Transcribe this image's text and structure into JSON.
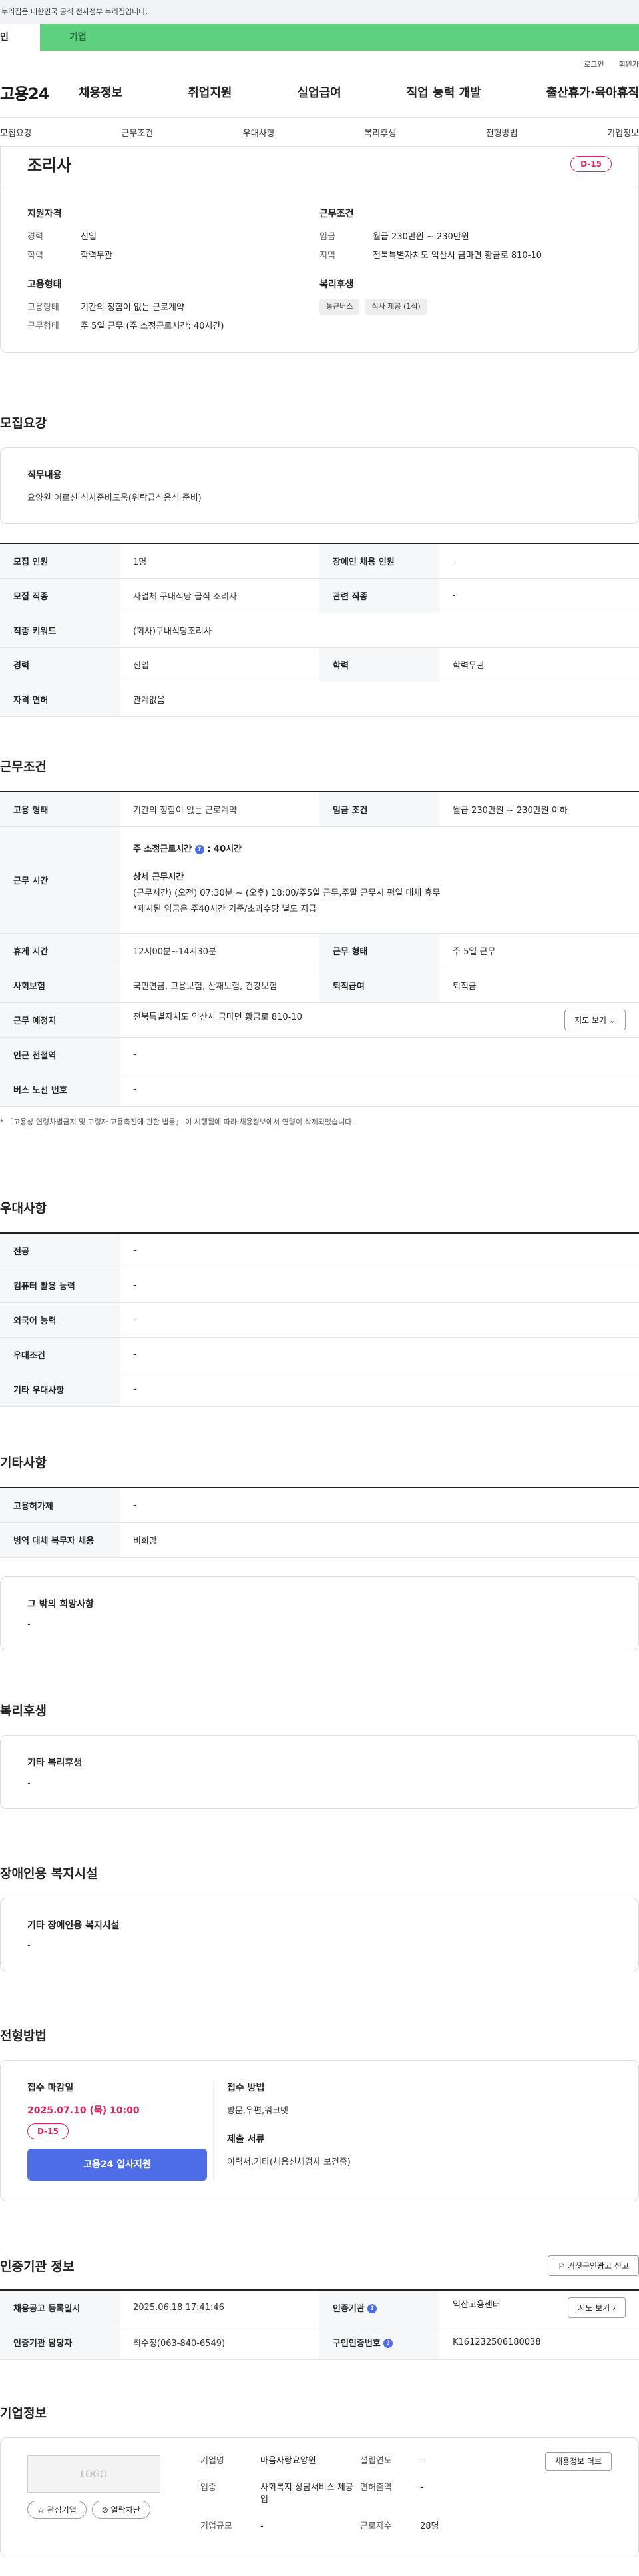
{
  "banner": "누리집은 대한민국 공식 전자정부 누리집입니다.",
  "tabs": {
    "a": "인",
    "b": "기업"
  },
  "util": {
    "login": "로그인",
    "join": "회원가"
  },
  "logo": "고용24",
  "gnb": [
    "채용정보",
    "취업지원",
    "실업급여",
    "직업 능력 개발",
    "출산휴가·육아휴직"
  ],
  "subtabs": [
    "모집요강",
    "근무조건",
    "우대사항",
    "복리후생",
    "전형방법",
    "기업정보"
  ],
  "job": {
    "title": "조리사",
    "dday": "D-15"
  },
  "summary": {
    "qual_h": "지원자격",
    "career_k": "경력",
    "career_v": "신입",
    "edu_k": "학력",
    "edu_v": "학력무관",
    "emp_h": "고용형태",
    "emptype_k": "고용형태",
    "emptype_v": "기간의 정함이 없는 근로계약",
    "workform_k": "근무형태",
    "workform_v": "주 5일 근무 (주 소정근로시간: 40시간)",
    "cond_h": "근무조건",
    "wage_k": "임금",
    "wage_v": "월급 230만원 ~ 230만원",
    "region_k": "지역",
    "region_v": "전북특별자치도 익산시 금마면 황금로 810-10",
    "welfare_h": "복리후생",
    "welfare_pills": [
      "통근버스",
      "식사 제공 (1식)"
    ]
  },
  "recruit": {
    "title": "모집요강",
    "duty_h": "직무내용",
    "duty_v": "요양원 어르신 식사준비도움(위탁급식음식 준비)",
    "rows": [
      [
        "모집 인원",
        "1명",
        "장애인 채용 인원",
        "-"
      ],
      [
        "모집 직종",
        "사업체 구내식당 급식 조리사",
        "관련 직종",
        "-"
      ],
      [
        "직종 키워드",
        "(회사)구내식당조리사"
      ],
      [
        "경력",
        "신입",
        "학력",
        "학력무관"
      ],
      [
        "자격 면허",
        "관계없음"
      ]
    ]
  },
  "work": {
    "title": "근무조건",
    "emp_k": "고용 형태",
    "emp_v": "기간의 정함이 없는 근로계약",
    "wage_k": "임금 조건",
    "wage_v": "월급 230만원 ~ 230만원 이하",
    "time_k": "근무 시간",
    "time_l1": "주 소정근로시간",
    "time_l1v": ": 40시간",
    "time_l2": "상세 근무시간",
    "time_l3": "(근무시간) (오전) 07:30분 ~ (오후) 18:00/주5일 근무,주말 근무시 평일 대체 휴무",
    "time_l4": "*제시된 임금은 주40시간 기준/초과수당 별도 지급",
    "rest_k": "휴게 시간",
    "rest_v": "12시00분~14시30분",
    "form_k": "근무 형태",
    "form_v": "주 5일 근무",
    "ins_k": "사회보험",
    "ins_v": "국민연금, 고용보험, 산재보험, 건강보험",
    "ret_k": "퇴직급여",
    "ret_v": "퇴직금",
    "place_k": "근무 예정지",
    "place_v": "전북특별자치도 익산시 금마면 황금로 810-10",
    "map": "지도 보기",
    "sub_k": "인근 전철역",
    "sub_v": "-",
    "bus_k": "버스 노선 번호",
    "bus_v": "-",
    "note": "* 「고용상 연령차별금지 및 고령자 고용촉진에 관한 법률」 이 시행됨에 따라 채용정보에서 연령이 삭제되었습니다."
  },
  "prefer": {
    "title": "우대사항",
    "rows": [
      [
        "전공",
        "-"
      ],
      [
        "컴퓨터 활용 능력",
        "-"
      ],
      [
        "외국어 능력",
        "-"
      ],
      [
        "우대조건",
        "-"
      ],
      [
        "기타 우대사항",
        "-"
      ]
    ]
  },
  "etc": {
    "title": "기타사항",
    "rows": [
      [
        "고용허가제",
        "-"
      ],
      [
        "병역 대체 복무자 채용",
        "비희망"
      ]
    ],
    "other_h": "그 밖의 희망사항",
    "other_v": "-"
  },
  "welfare": {
    "title": "복리후생",
    "h": "기타 복리후생",
    "v": "-"
  },
  "disabled": {
    "title": "장애인용 복지시설",
    "h": "기타 장애인용 복지시설",
    "v": "-"
  },
  "process": {
    "title": "전형방법",
    "deadline_h": "접수 마감일",
    "deadline_v": "2025.07.10 (목) 10:00",
    "dday": "D-15",
    "apply": "고용24 입사지원",
    "method_h": "접수 방법",
    "method_v": "방문,우편,워크넷",
    "docs_h": "제출 서류",
    "docs_v": "이력서,기타(채용신체검사 보건증)"
  },
  "agency": {
    "title": "인증기관 정보",
    "report": "거짓구인광고 신고",
    "reg_k": "채용공고 등록일시",
    "reg_v": "2025.06.18 17:41:46",
    "org_k": "인증기관",
    "org_v": "익산고용센터",
    "map": "지도 보기",
    "mgr_k": "인증기관 담당자",
    "mgr_v": "최수정(063-840-6549)",
    "no_k": "구인인증번호",
    "no_v": "K161232506180038"
  },
  "company": {
    "title": "기업정보",
    "logo": "LOGO",
    "fav": "관심기업",
    "block": "열람차단",
    "name_k": "기업명",
    "name_v": "마음사랑요양원",
    "ind_k": "업종",
    "ind_v": "사회복지 상담서비스 제공업",
    "size_k": "기업규모",
    "size_v": "-",
    "est_k": "설립연도",
    "est_v": "-",
    "cap_k": "면허출역",
    "cap_v": "-",
    "emp_k": "근로자수",
    "emp_v": "28명",
    "more": "채용정보 더보"
  }
}
